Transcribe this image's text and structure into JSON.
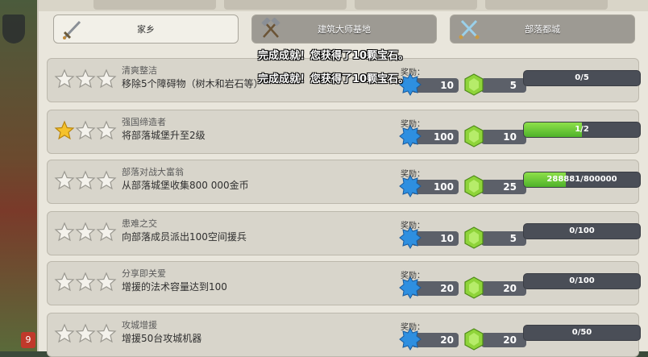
{
  "tabs": [
    {
      "label": "家乡",
      "icon": "sword-icon",
      "active": true
    },
    {
      "label": "建筑大师基地",
      "icon": "crossed-hammers-icon",
      "active": false
    },
    {
      "label": "部落都城",
      "icon": "crossed-swords-icon",
      "active": false
    }
  ],
  "reward_label": "奖励：",
  "achievements": [
    {
      "title": "清爽整洁",
      "desc": "移除5个障碍物（树木和岩石等）",
      "stars": 0,
      "xp": "10",
      "gems": "5",
      "progress_text": "0/5",
      "progress": 0
    },
    {
      "title": "强国缔造者",
      "desc": "将部落城堡升至2级",
      "stars": 1,
      "xp": "100",
      "gems": "10",
      "progress_text": "1/2",
      "progress": 0.5
    },
    {
      "title": "部落对战大富翁",
      "desc": "从部落城堡收集800 000金币",
      "stars": 0,
      "xp": "100",
      "gems": "25",
      "progress_text": "288881/800000",
      "progress": 0.361
    },
    {
      "title": "患难之交",
      "desc": "向部落成员派出100空间援兵",
      "stars": 0,
      "xp": "10",
      "gems": "5",
      "progress_text": "0/100",
      "progress": 0
    },
    {
      "title": "分享即关爱",
      "desc": "增援的法术容量达到100",
      "stars": 0,
      "xp": "20",
      "gems": "20",
      "progress_text": "0/100",
      "progress": 0
    },
    {
      "title": "攻城增援",
      "desc": "增援50台攻城机器",
      "stars": 0,
      "xp": "20",
      "gems": "20",
      "progress_text": "0/50",
      "progress": 0
    }
  ],
  "notifications": [
    "完成成就！您获得了10颗宝石。",
    "完成成就！您获得了10颗宝石。"
  ],
  "corner_badge": "9",
  "colors": {
    "progress_fill": "#6cc93a",
    "star_gold": "#f5c22b",
    "star_empty": "#f4f2ec"
  }
}
